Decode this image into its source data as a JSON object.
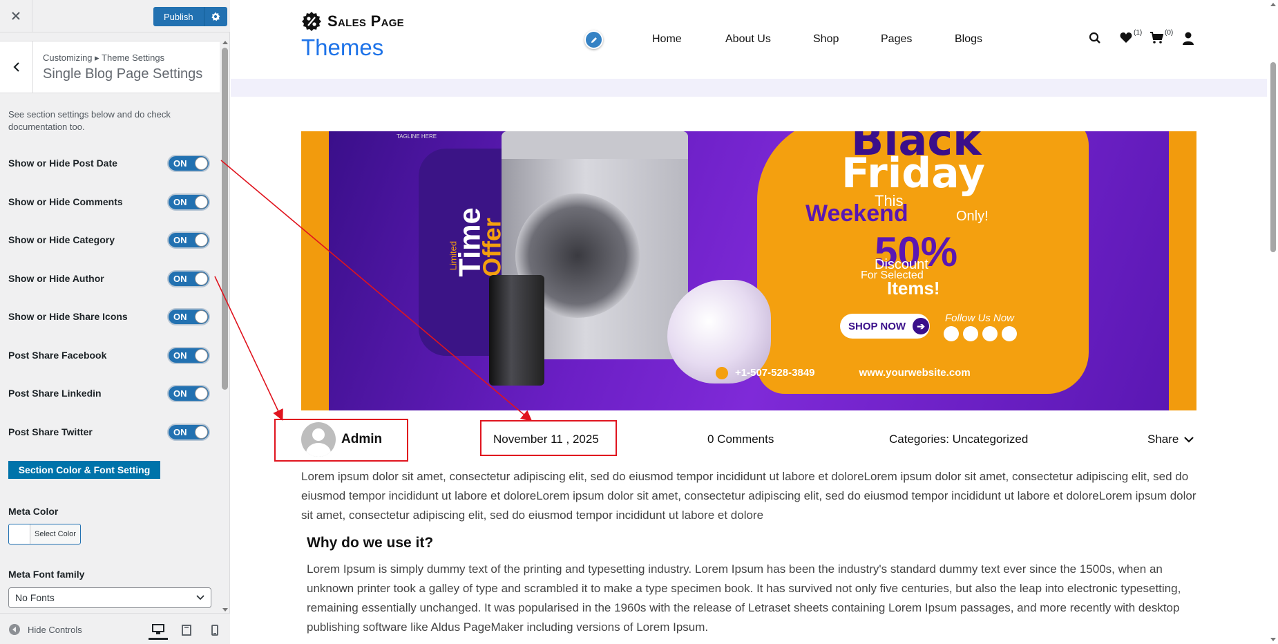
{
  "customizer": {
    "publish_label": "Publish",
    "breadcrumb": "Customizing ▸ Theme Settings",
    "title": "Single Blog Page Settings",
    "description": "See section settings below and do check documentation too.",
    "toggles": [
      {
        "label": "Show or Hide Post Date",
        "state": "ON"
      },
      {
        "label": "Show or Hide Comments",
        "state": "ON"
      },
      {
        "label": "Show or Hide Category",
        "state": "ON"
      },
      {
        "label": "Show or Hide Author",
        "state": "ON"
      },
      {
        "label": "Show or Hide Share Icons",
        "state": "ON"
      },
      {
        "label": "Post Share Facebook",
        "state": "ON"
      },
      {
        "label": "Post Share Linkedin",
        "state": "ON"
      },
      {
        "label": "Post Share Twitter",
        "state": "ON"
      }
    ],
    "section_button": "Section Color & Font Setting",
    "meta_color_label": "Meta Color",
    "select_color": "Select Color",
    "meta_font_label": "Meta Font family",
    "font_value": "No Fonts",
    "hide_controls": "Hide Controls",
    "colors": {
      "primary": "#2271b1",
      "section": "#0073aa"
    }
  },
  "site": {
    "logo_top": "Sales Page",
    "logo_sub": "Themes",
    "nav": [
      "Home",
      "About Us",
      "Shop",
      "Pages",
      "Blogs"
    ],
    "wishlist_count": "(1)",
    "cart_count": "(0)",
    "accent": "#1e73e8"
  },
  "banner": {
    "tagline": "TAGLINE HERE",
    "limited": "Limited",
    "time": "Time",
    "offer": "Offer",
    "black": "Black",
    "friday": "Friday",
    "this": "This",
    "weekend": "Weekend",
    "only": "Only!",
    "percent": "50%",
    "discount": "Discount",
    "for_selected": "For Selected",
    "items": "Items!",
    "shop_now": "SHOP NOW",
    "follow": "Follow Us Now",
    "phone": "+1-507-528-3849",
    "website": "www.yourwebsite.com"
  },
  "post": {
    "author": "Admin",
    "date": "November 11 , 2025",
    "comments": "0 Comments",
    "categories": "Categories: Uncategorized",
    "share": "Share",
    "intro": "Lorem ipsum dolor sit amet, consectetur adipiscing elit, sed do eiusmod tempor incididunt ut labore et doloreLorem ipsum dolor sit amet, consectetur adipiscing elit, sed do eiusmod tempor incididunt ut labore et doloreLorem ipsum dolor sit amet, consectetur adipiscing elit, sed do eiusmod tempor incididunt ut labore et doloreLorem ipsum dolor sit amet, consectetur adipiscing elit, sed do eiusmod tempor incididunt ut labore et dolore",
    "heading": "Why do we use it?",
    "body": "Lorem Ipsum is simply dummy text of the printing and typesetting industry. Lorem Ipsum has been the industry's standard dummy text ever since the 1500s, when an unknown printer took a galley of type and scrambled it to make a type specimen book. It has survived not only five centuries, but also the leap into electronic typesetting, remaining essentially unchanged. It was popularised in the 1960s with the release of Letraset sheets containing Lorem Ipsum passages, and more recently with desktop publishing software like Aldus PageMaker including versions of Lorem Ipsum."
  },
  "annotations": {
    "color": "#e0141e"
  }
}
